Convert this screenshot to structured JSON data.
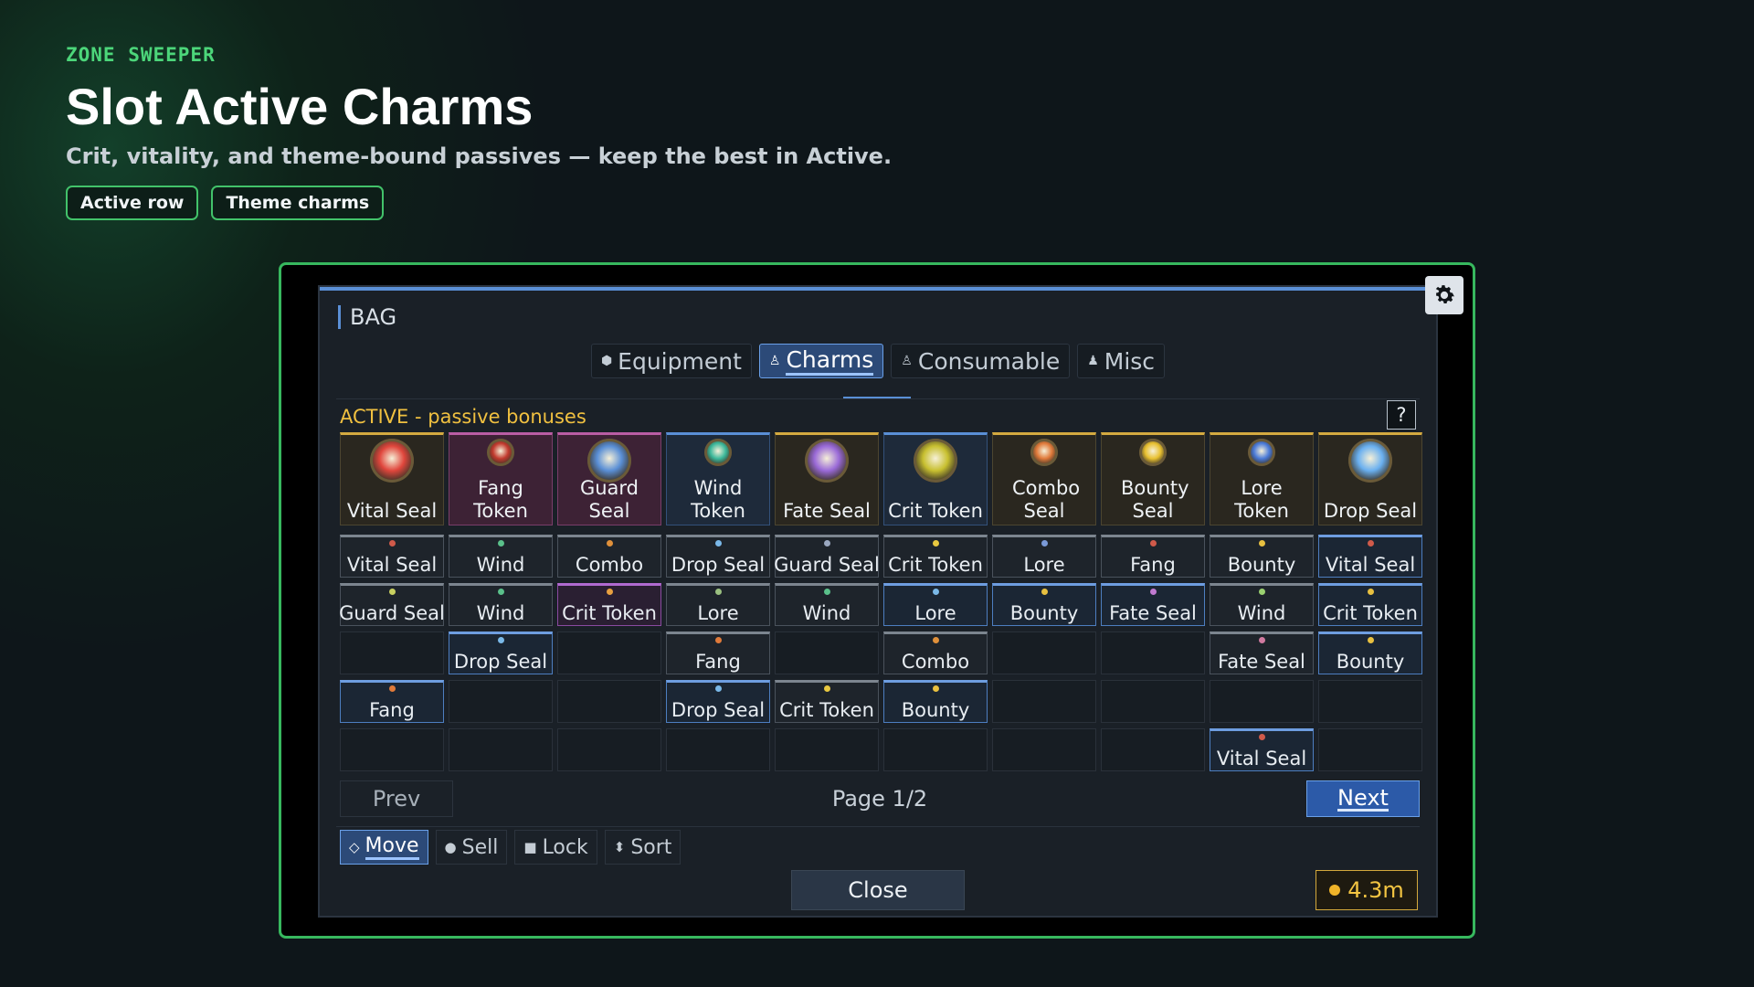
{
  "hero": {
    "eyebrow": "ZONE SWEEPER",
    "title": "Slot Active Charms",
    "subtitle": "Crit, vitality, and theme-bound passives — keep the best in Active.",
    "chips": [
      "Active row",
      "Theme charms"
    ]
  },
  "bag": {
    "label": "BAG",
    "tabs": [
      {
        "label": "Equipment",
        "icon": "gem-icon",
        "active": false
      },
      {
        "label": "Charms",
        "icon": "charm-icon",
        "active": true
      },
      {
        "label": "Consumable",
        "icon": "potion-icon",
        "active": false
      },
      {
        "label": "Misc",
        "icon": "flask-icon",
        "active": false
      }
    ],
    "active_label": "ACTIVE - passive bonuses",
    "help": "?",
    "active_slots": [
      {
        "name": "Vital Seal",
        "style": "gold",
        "icon_color": "#e0463c",
        "icon_size": "large"
      },
      {
        "name": "Fang Token",
        "style": "pink",
        "icon_color": "#c23a2e",
        "icon_size": "small"
      },
      {
        "name": "Guard Seal",
        "style": "pink",
        "icon_color": "#5a8fd6",
        "icon_size": "large"
      },
      {
        "name": "Wind Token",
        "style": "blue",
        "icon_color": "#3cb89a",
        "icon_size": "small"
      },
      {
        "name": "Fate Seal",
        "style": "gold",
        "icon_color": "#9a6ad8",
        "icon_size": "large"
      },
      {
        "name": "Crit Token",
        "style": "blue",
        "icon_color": "#c8c030",
        "icon_size": "large"
      },
      {
        "name": "Combo Seal",
        "style": "gold",
        "icon_color": "#e07a3a",
        "icon_size": "small"
      },
      {
        "name": "Bounty Seal",
        "style": "gold",
        "icon_color": "#e8c030",
        "icon_size": "small"
      },
      {
        "name": "Lore Token",
        "style": "gold",
        "icon_color": "#4a7ad8",
        "icon_size": "small"
      },
      {
        "name": "Drop Seal",
        "style": "gold",
        "icon_color": "#6ab0f0",
        "icon_size": "large"
      }
    ],
    "grid": [
      {
        "label": "Vital Seal",
        "style": "filled",
        "dot": "#d05a4a"
      },
      {
        "label": "Wind",
        "style": "filled",
        "dot": "#5ac08a"
      },
      {
        "label": "Combo",
        "style": "filled",
        "dot": "#e0903a"
      },
      {
        "label": "Drop Seal",
        "style": "filled",
        "dot": "#7ab8e8"
      },
      {
        "label": "Guard Seal",
        "style": "filled",
        "dot": "#9aa8c0"
      },
      {
        "label": "Crit Token",
        "style": "filled",
        "dot": "#e8c840"
      },
      {
        "label": "Lore",
        "style": "filled",
        "dot": "#7a9ad8"
      },
      {
        "label": "Fang",
        "style": "filled",
        "dot": "#d05a4a"
      },
      {
        "label": "Bounty",
        "style": "filled",
        "dot": "#e8c040"
      },
      {
        "label": "Vital Seal",
        "style": "blue",
        "dot": "#d05a4a"
      },
      {
        "label": "Guard Seal",
        "style": "filled",
        "dot": "#c8d060"
      },
      {
        "label": "Wind",
        "style": "filled",
        "dot": "#5ac08a"
      },
      {
        "label": "Crit Token",
        "style": "purple",
        "dot": "#e8a040"
      },
      {
        "label": "Lore",
        "style": "filled",
        "dot": "#9ac080"
      },
      {
        "label": "Wind",
        "style": "filled",
        "dot": "#5ac08a"
      },
      {
        "label": "Lore",
        "style": "blue",
        "dot": "#7ab8e8"
      },
      {
        "label": "Bounty",
        "style": "blue",
        "dot": "#e8c040"
      },
      {
        "label": "Fate Seal",
        "style": "blue",
        "dot": "#c07ad0"
      },
      {
        "label": "Wind",
        "style": "filled",
        "dot": "#9ad070"
      },
      {
        "label": "Crit Token",
        "style": "blue",
        "dot": "#e8c040"
      },
      {
        "label": "",
        "style": "empty",
        "dot": ""
      },
      {
        "label": "Drop Seal",
        "style": "blue",
        "dot": "#7ab8e8"
      },
      {
        "label": "",
        "style": "empty",
        "dot": ""
      },
      {
        "label": "Fang",
        "style": "filled",
        "dot": "#e07a3a"
      },
      {
        "label": "",
        "style": "empty",
        "dot": ""
      },
      {
        "label": "Combo",
        "style": "filled",
        "dot": "#e0903a"
      },
      {
        "label": "",
        "style": "empty",
        "dot": ""
      },
      {
        "label": "",
        "style": "empty",
        "dot": ""
      },
      {
        "label": "Fate Seal",
        "style": "filled",
        "dot": "#d07aa0"
      },
      {
        "label": "Bounty",
        "style": "blue",
        "dot": "#e8c040"
      },
      {
        "label": "Fang",
        "style": "blue",
        "dot": "#e07a3a"
      },
      {
        "label": "",
        "style": "empty",
        "dot": ""
      },
      {
        "label": "",
        "style": "empty",
        "dot": ""
      },
      {
        "label": "Drop Seal",
        "style": "blue",
        "dot": "#7ab8e8"
      },
      {
        "label": "Crit Token",
        "style": "filled",
        "dot": "#e8c840"
      },
      {
        "label": "Bounty",
        "style": "blue",
        "dot": "#e8c040"
      },
      {
        "label": "",
        "style": "empty",
        "dot": ""
      },
      {
        "label": "",
        "style": "empty",
        "dot": ""
      },
      {
        "label": "",
        "style": "empty",
        "dot": ""
      },
      {
        "label": "",
        "style": "empty",
        "dot": ""
      },
      {
        "label": "",
        "style": "empty",
        "dot": ""
      },
      {
        "label": "",
        "style": "empty",
        "dot": ""
      },
      {
        "label": "",
        "style": "empty",
        "dot": ""
      },
      {
        "label": "",
        "style": "empty",
        "dot": ""
      },
      {
        "label": "",
        "style": "empty",
        "dot": ""
      },
      {
        "label": "",
        "style": "empty",
        "dot": ""
      },
      {
        "label": "",
        "style": "empty",
        "dot": ""
      },
      {
        "label": "",
        "style": "empty",
        "dot": ""
      },
      {
        "label": "Vital Seal",
        "style": "blue",
        "dot": "#d05a4a"
      },
      {
        "label": "",
        "style": "empty",
        "dot": ""
      }
    ],
    "prev": "Prev",
    "page": "Page 1/2",
    "next": "Next",
    "tools": [
      {
        "label": "Move",
        "icon": "move-icon",
        "glyph": "⟡",
        "active": true
      },
      {
        "label": "Sell",
        "icon": "coin-icon",
        "glyph": "●",
        "active": false
      },
      {
        "label": "Lock",
        "icon": "lock-icon",
        "glyph": "🔒︎",
        "active": false
      },
      {
        "label": "Sort",
        "icon": "sort-icon",
        "glyph": "⬍",
        "active": false
      }
    ],
    "close": "Close",
    "gold": "4.3m"
  },
  "colors": {
    "accent_green": "#37b85e",
    "accent_blue": "#5a8fd6",
    "gold": "#f4c542"
  }
}
